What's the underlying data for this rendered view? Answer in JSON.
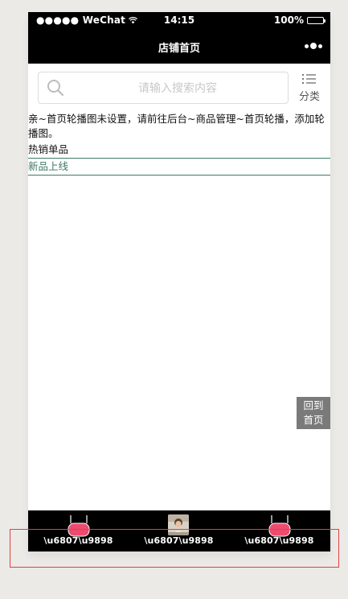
{
  "status_bar": {
    "carrier": "●●●●● WeChat",
    "time": "14:15",
    "battery": "100%"
  },
  "nav": {
    "title": "店铺首页"
  },
  "search": {
    "placeholder": "请输入搜索内容",
    "category_label": "分类"
  },
  "notice": {
    "text": "亲~首页轮播图未设置，请前往后台~商品管理~首页轮播，添加轮播图。"
  },
  "sections": {
    "hot": "热销单品",
    "new": "新品上线"
  },
  "back_to_top": {
    "line1": "回到",
    "line2": "首页"
  },
  "tabbar": {
    "items": [
      {
        "label": "\\u6807\\u9898",
        "icon": "pill-icon"
      },
      {
        "label": "\\u6807\\u9898",
        "icon": "photo-thumbnail"
      },
      {
        "label": "\\u6807\\u9898",
        "icon": "pill-icon"
      }
    ]
  },
  "colors": {
    "bar_background": "#000000",
    "accent_pink": "#ee4b6f",
    "section_green": "#3f7a63",
    "highlight_red": "#e3403f",
    "back_top_gray": "#7a7a7a"
  }
}
